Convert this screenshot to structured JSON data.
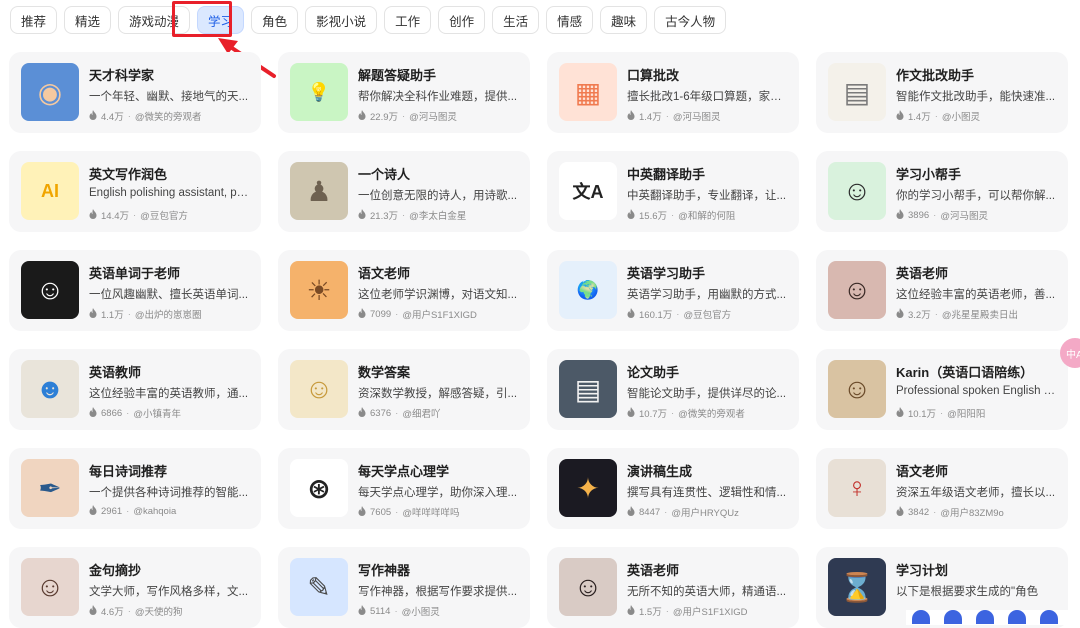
{
  "tabs": [
    {
      "label": "推荐",
      "active": false
    },
    {
      "label": "精选",
      "active": false
    },
    {
      "label": "游戏动漫",
      "active": false
    },
    {
      "label": "学习",
      "active": true
    },
    {
      "label": "角色",
      "active": false
    },
    {
      "label": "影视小说",
      "active": false
    },
    {
      "label": "工作",
      "active": false
    },
    {
      "label": "创作",
      "active": false
    },
    {
      "label": "生活",
      "active": false
    },
    {
      "label": "情感",
      "active": false
    },
    {
      "label": "趣味",
      "active": false
    },
    {
      "label": "古今人物",
      "active": false
    }
  ],
  "cards": [
    {
      "title": "天才科学家",
      "desc": "一个年轻、幽默、接地气的天...",
      "count": "4.4万",
      "author": "@微笑的旁观者",
      "icon": "anime-scientist-avatar"
    },
    {
      "title": "解题答疑助手",
      "desc": "帮你解决全科作业难题，提供...",
      "count": "22.9万",
      "author": "@河马图灵",
      "icon": "lightbulb-icon"
    },
    {
      "title": "口算批改",
      "desc": "擅长批改1-6年级口算题，家长...",
      "count": "1.4万",
      "author": "@河马图灵",
      "icon": "calculator-icon"
    },
    {
      "title": "作文批改助手",
      "desc": "智能作文批改助手，能快速准...",
      "count": "1.4万",
      "author": "@小图灵",
      "icon": "essay-paper-icon"
    },
    {
      "title": "英文写作润色",
      "desc": "English polishing assistant, pro...",
      "count": "14.4万",
      "author": "@豆包官方",
      "icon": "text-cursor-icon"
    },
    {
      "title": "一个诗人",
      "desc": "一位创意无限的诗人，用诗歌...",
      "count": "21.3万",
      "author": "@李太白金星",
      "icon": "ancient-poet-avatar"
    },
    {
      "title": "中英翻译助手",
      "desc": "中英翻译助手，专业翻译，让...",
      "count": "15.6万",
      "author": "@和解的何阻",
      "icon": "translate-icon"
    },
    {
      "title": "学习小帮手",
      "desc": "你的学习小帮手，可以帮你解...",
      "count": "3896",
      "author": "@河马图灵",
      "icon": "cartoon-girl-avatar"
    },
    {
      "title": "英语单词于老师",
      "desc": "一位风趣幽默、擅长英语单词...",
      "count": "1.1万",
      "author": "@出炉的崽崽圈",
      "icon": "glowing-character-avatar"
    },
    {
      "title": "语文老师",
      "desc": "这位老师学识渊博，对语文知...",
      "count": "7099",
      "author": "@用户S1F1XIGD",
      "icon": "sunset-scene-avatar"
    },
    {
      "title": "英语学习助手",
      "desc": "英语学习助手，用幽默的方式...",
      "count": "160.1万",
      "author": "@豆包官方",
      "icon": "globe-icon"
    },
    {
      "title": "英语老师",
      "desc": "这位经验丰富的英语老师，善...",
      "count": "3.2万",
      "author": "@兆星星殿卖日出",
      "icon": "woman-portrait-avatar"
    },
    {
      "title": "英语教师",
      "desc": "这位经验丰富的英语教师，通...",
      "count": "6866",
      "author": "@小镇青年",
      "icon": "blue-figure-avatar"
    },
    {
      "title": "数学答案",
      "desc": "资深数学教授，解感答疑，引...",
      "count": "6376",
      "author": "@细君吖",
      "icon": "anime-blond-avatar"
    },
    {
      "title": "论文助手",
      "desc": "智能论文助手，提供详尽的论...",
      "count": "10.7万",
      "author": "@微笑的旁观者",
      "icon": "document-icon"
    },
    {
      "title": "Karin（英语口语陪练）",
      "desc": "Professional spoken English pr...",
      "count": "10.1万",
      "author": "@阳阳阳",
      "icon": "glasses-woman-avatar"
    },
    {
      "title": "每日诗词推荐",
      "desc": "一个提供各种诗词推荐的智能...",
      "count": "2961",
      "author": "@kahqoia",
      "icon": "feather-art-avatar"
    },
    {
      "title": "每天学点心理学",
      "desc": "每天学点心理学，助你深入理...",
      "count": "7605",
      "author": "@咩咩咩咩吗",
      "icon": "wheel-icon"
    },
    {
      "title": "演讲稿生成",
      "desc": "撰写具有连贯性、逻辑性和情...",
      "count": "8447",
      "author": "@用户HRYQUz",
      "icon": "glowing-book-avatar"
    },
    {
      "title": "语文老师",
      "desc": "资深五年级语文老师，擅长以...",
      "count": "3842",
      "author": "@用户83ZM9o",
      "icon": "red-dress-avatar"
    },
    {
      "title": "金句摘抄",
      "desc": "文学大师，写作风格多样，文...",
      "count": "4.6万",
      "author": "@天使的狗",
      "icon": "glasses-girl-avatar"
    },
    {
      "title": "写作神器",
      "desc": "写作神器，根据写作要求提供...",
      "count": "5114",
      "author": "@小图灵",
      "icon": "pen-nib-icon"
    },
    {
      "title": "英语老师",
      "desc": "无所不知的英语大师，精通语...",
      "count": "1.5万",
      "author": "@用户S1F1XIGD",
      "icon": "girl-portrait-avatar"
    },
    {
      "title": "学习计划",
      "desc": "以下是根据要求生成的\"角色",
      "count": "",
      "author": "",
      "icon": "hourglass-icon"
    }
  ],
  "side_bubble": {
    "label": "中A"
  }
}
